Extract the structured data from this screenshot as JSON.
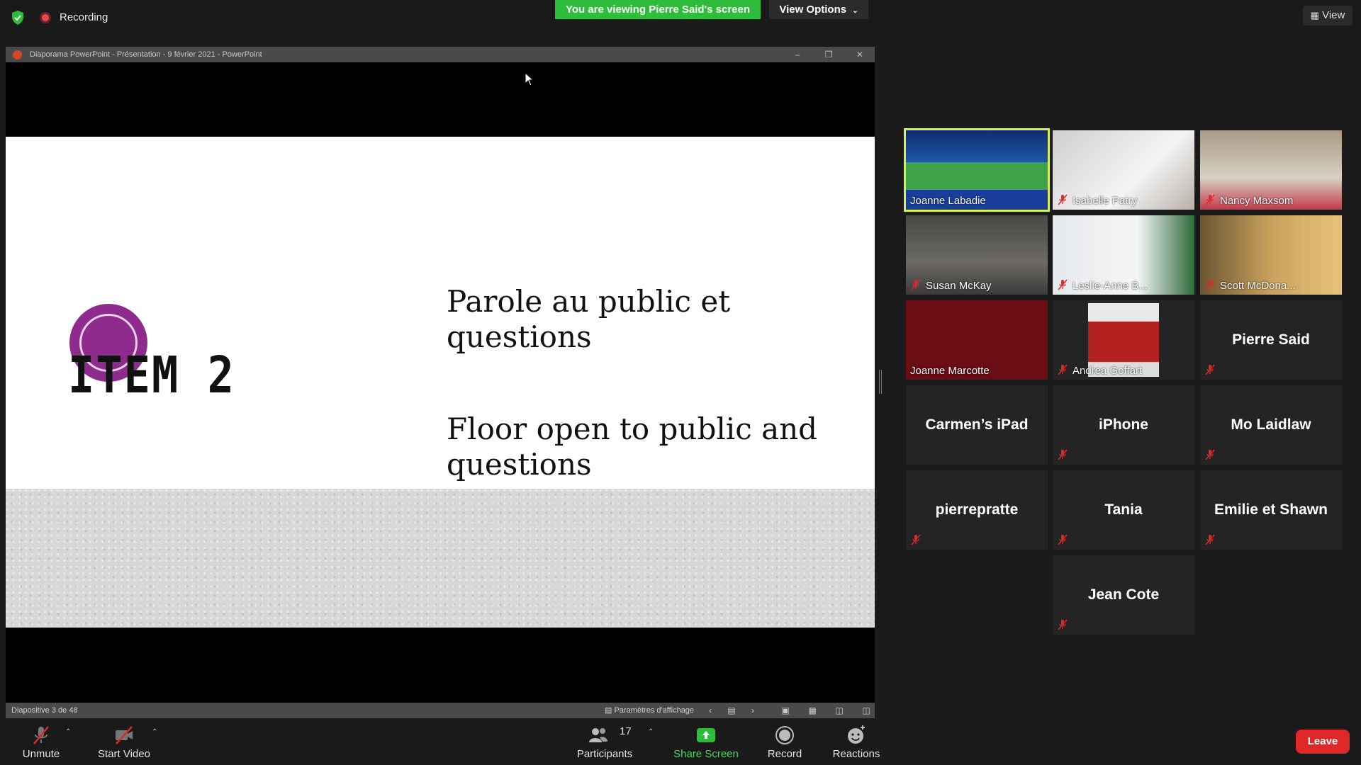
{
  "topbar": {
    "recording_label": "Recording",
    "viewing_banner": "You are viewing Pierre Said's screen",
    "view_options": "View Options",
    "view_button": "View"
  },
  "shared_window": {
    "title": "Diaporama PowerPoint  -  Présentation - 9 février 2021 - PowerPoint",
    "slide": {
      "item_label": "ITEM 2",
      "text_fr": "Parole au public et questions",
      "text_en": "Floor open to public and questions"
    },
    "status": {
      "slide_counter": "Diapositive 3 de 48",
      "display_settings": "Paramètres d'affichage"
    }
  },
  "gallery": [
    {
      "name": "Joanne Labadie",
      "muted": false,
      "active": true,
      "video": true
    },
    {
      "name": "Isabelle Patry",
      "muted": true,
      "video": true
    },
    {
      "name": "Nancy Maxsom",
      "muted": true,
      "video": true
    },
    {
      "name": "Susan McKay",
      "muted": true,
      "video": true
    },
    {
      "name": "Leslie-Anne B...",
      "muted": true,
      "video": true
    },
    {
      "name": "Scott McDona...",
      "muted": true,
      "video": true
    },
    {
      "name": "Joanne Marcotte",
      "muted": false,
      "video": true
    },
    {
      "name": "Andrea Goffart",
      "muted": true,
      "video": true
    },
    {
      "name": "Pierre Said",
      "muted": true,
      "video": false
    },
    {
      "name": "Carmen’s iPad",
      "muted": false,
      "video": false
    },
    {
      "name": "iPhone",
      "muted": true,
      "video": false
    },
    {
      "name": "Mo Laidlaw",
      "muted": true,
      "video": false
    },
    {
      "name": "pierrepratte",
      "muted": true,
      "video": false
    },
    {
      "name": "Tania",
      "muted": true,
      "video": false
    },
    {
      "name": "Emilie et Shawn",
      "muted": true,
      "video": false
    },
    {
      "name": "Jean Cote",
      "muted": true,
      "video": false
    }
  ],
  "toolbar": {
    "unmute": "Unmute",
    "start_video": "Start Video",
    "participants": "Participants",
    "participant_count": "17",
    "share_screen": "Share Screen",
    "record": "Record",
    "reactions": "Reactions",
    "leave": "Leave"
  },
  "colors": {
    "banner_green": "#2ebd3a",
    "active_speaker": "#d9f04a",
    "leave_red": "#e02828",
    "slide_purple": "#8e2b8c"
  }
}
